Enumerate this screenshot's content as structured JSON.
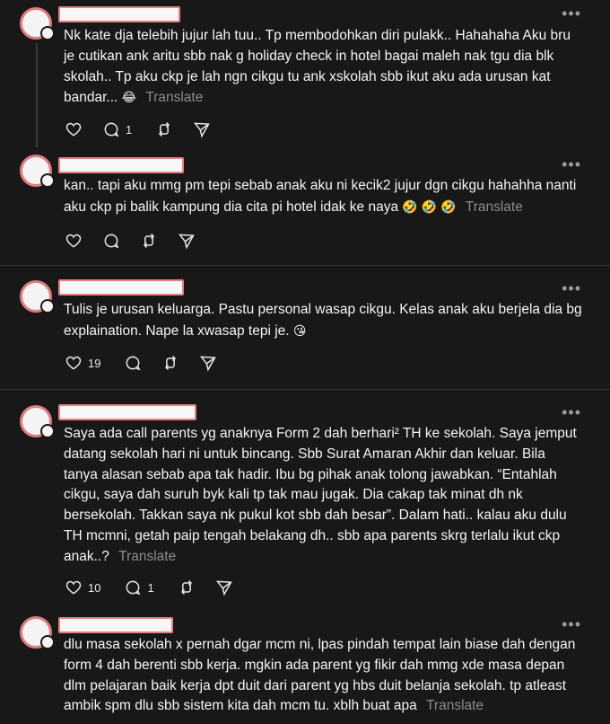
{
  "posts": [
    {
      "text": "Nk kate dja telebih jujur lah tuu.. Tp membodohkan diri pulakk.. Hahahaha Aku bru je cutikan ank aritu sbb nak g holiday check in hotel bagai maleh nak tgu dia blk skolah.. Tp aku ckp je lah ngn cikgu tu ank xskolah sbb ikut aku ada urusan kat bandar...",
      "emoji": "😂",
      "translate": "Translate",
      "reply_count": "1",
      "like_count": ""
    },
    {
      "text": "kan.. tapi aku mmg pm tepi sebab anak aku ni kecik2 jujur dgn cikgu hahahha nanti aku ckp pi balik kampung dia cita pi hotel idak ke naya",
      "emoji": "🤣 🤣 🤣",
      "translate": "Translate",
      "reply_count": "",
      "like_count": ""
    },
    {
      "text": "Tulis je urusan keluarga. Pastu personal wasap cikgu. Kelas anak aku berjela dia bg explaination. Nape la xwasap tepi je.",
      "emoji": "😘",
      "translate": "",
      "reply_count": "",
      "like_count": "19"
    },
    {
      "text": "Saya ada call parents yg anaknya Form 2 dah berhari² TH ke sekolah. Saya jemput datang sekolah hari ni untuk bincang. Sbb Surat Amaran Akhir dan keluar. Bila tanya alasan sebab apa tak hadir. Ibu bg pihak anak tolong jawabkan. “Entahlah cikgu, saya dah suruh byk kali tp tak mau jugak. Dia cakap tak minat dh nk bersekolah. Takkan saya nk pukul kot sbb dah besar”. Dalam hati.. kalau aku dulu TH mcmni, getah paip tengah belakang dh.. sbb apa parents skrg terlalu ikut ckp anak..?",
      "emoji": "",
      "translate": "Translate",
      "reply_count": "1",
      "like_count": "10"
    },
    {
      "text": "dlu masa sekolah x pernah dgar mcm ni, lpas pindah tempat lain biase dah dengan form 4 dah berenti sbb kerja. mgkin ada parent yg fikir dah mmg xde masa depan dlm pelajaran baik kerja dpt duit dari parent yg hbs duit belanja sekolah. tp atleast ambik spm dlu sbb sistem kita dah mcm tu. xblh buat apa",
      "emoji": "",
      "translate": "Translate",
      "reply_count": "",
      "like_count": ""
    }
  ],
  "icons": {
    "like": "heart-icon",
    "reply": "comment-icon",
    "repost": "repost-icon",
    "share": "send-icon",
    "more": "more-icon"
  },
  "colors": {
    "background": "#181818",
    "text": "#f3f5f7",
    "muted": "#8c8c8c",
    "redaction_border": "#e48082"
  }
}
